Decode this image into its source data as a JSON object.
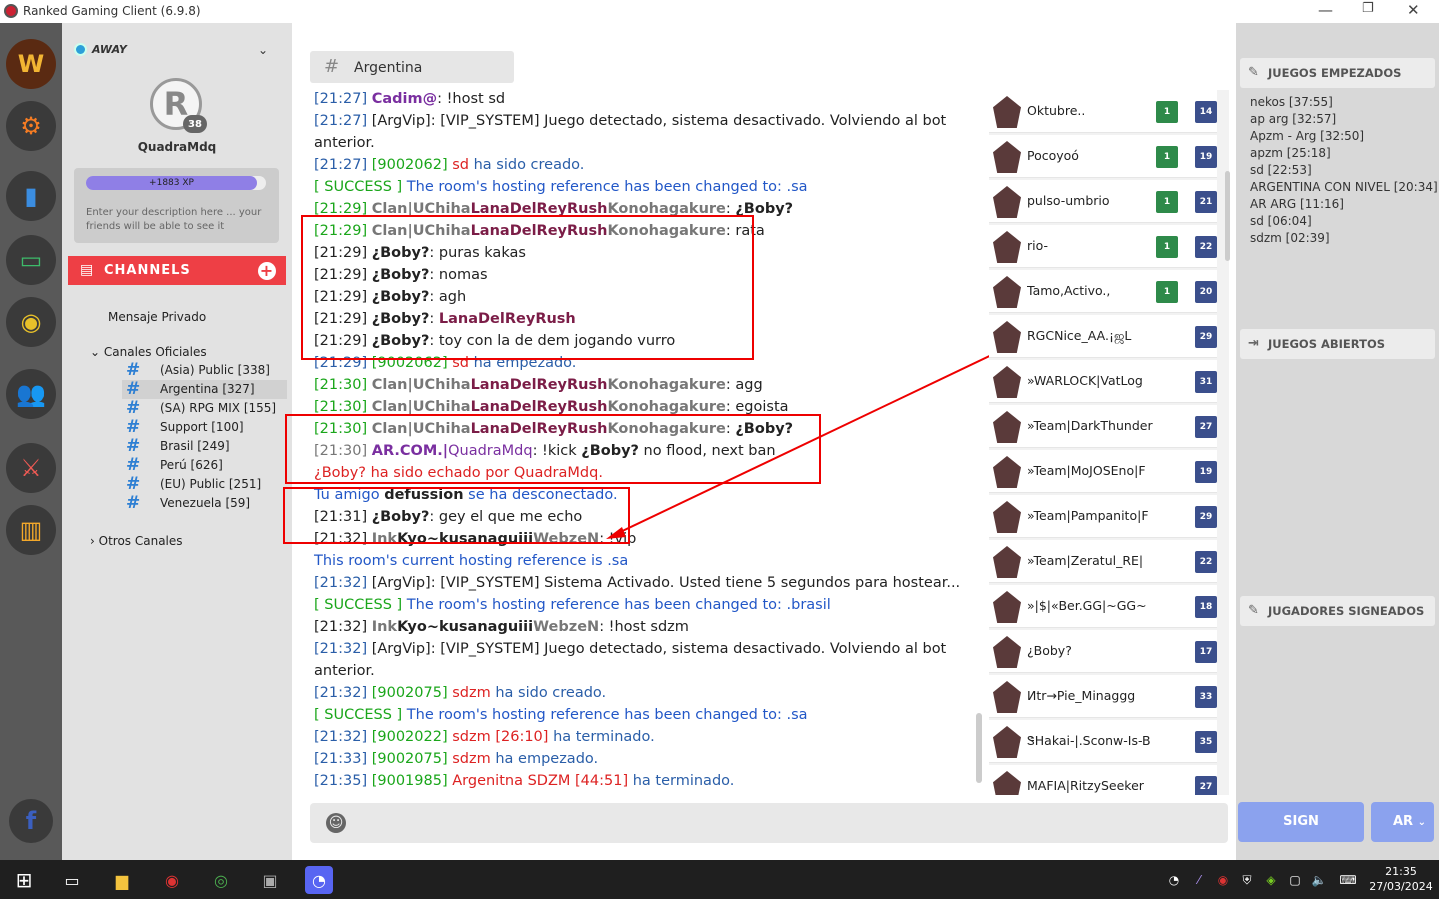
{
  "window": {
    "title": "Ranked Gaming Client (6.9.8)",
    "min": "—",
    "max": "❐",
    "close": "✕"
  },
  "sidebar": {
    "status": "AWAY",
    "avatar_letter": "R",
    "level": "38",
    "username": "QuadraMdq",
    "xp": "+1883 XP",
    "xp_fraction": 0.95,
    "description": "Enter your description here ... your friends will be able to see it",
    "channels_label": "CHANNELS",
    "private": "Mensaje Privado",
    "official_group": "Canales Oficiales",
    "other_group": "Otros Canales",
    "channels": [
      {
        "name": "(Asia) Public [338]"
      },
      {
        "name": "Argentina [327]"
      },
      {
        "name": "(SA) RPG MIX [155]"
      },
      {
        "name": "Support [100]"
      },
      {
        "name": "Brasil [249]"
      },
      {
        "name": "Perú [626]"
      },
      {
        "name": "(EU) Public [251]"
      },
      {
        "name": "Venezuela [59]"
      }
    ]
  },
  "chat": {
    "channel": "Argentina",
    "lines": [
      [
        [
          "[21:27] ",
          "tm"
        ],
        [
          "Cadim@",
          "mag b"
        ],
        [
          ": !host sd",
          ""
        ]
      ],
      [
        [
          "[21:27] ",
          "tm"
        ],
        [
          "[ArgVip]",
          ""
        ],
        [
          ": [VIP_SYSTEM] Juego detectado, sistema desactivado. Volviendo al bot",
          ""
        ]
      ],
      [
        [
          "anterior.",
          ""
        ]
      ],
      [
        [
          "[21:27] ",
          "tm"
        ],
        [
          "[9002062] ",
          "grn"
        ],
        [
          "sd ",
          "red"
        ],
        [
          "ha sido creado.",
          "tm"
        ]
      ],
      [
        [
          "[ SUCCESS ] ",
          "grn"
        ],
        [
          "The room's hosting reference has been changed to: ",
          "bl"
        ],
        [
          ".sa",
          "bl"
        ]
      ],
      [
        [
          "[21:29] ",
          "grn"
        ],
        [
          "Clan|UChiha",
          "gr b"
        ],
        [
          "LanaDelReyRush",
          "pur b"
        ],
        [
          "Konohagakure",
          "gr b"
        ],
        [
          ": ",
          ""
        ],
        [
          "¿Boby?",
          "b"
        ]
      ],
      [
        [
          "[21:29] ",
          "grn"
        ],
        [
          "Clan|UChiha",
          "gr b"
        ],
        [
          "LanaDelReyRush",
          "pur b"
        ],
        [
          "Konohagakure",
          "gr b"
        ],
        [
          ": rata",
          ""
        ]
      ],
      [
        [
          "[21:29] ",
          ""
        ],
        [
          "¿Boby?",
          "b"
        ],
        [
          ": puras kakas",
          ""
        ]
      ],
      [
        [
          "[21:29] ",
          ""
        ],
        [
          "¿Boby?",
          "b"
        ],
        [
          ": nomas",
          ""
        ]
      ],
      [
        [
          "[21:29] ",
          ""
        ],
        [
          "¿Boby?",
          "b"
        ],
        [
          ": agh",
          ""
        ]
      ],
      [
        [
          "[21:29] ",
          ""
        ],
        [
          "¿Boby?",
          "b"
        ],
        [
          ": ",
          ""
        ],
        [
          "LanaDelReyRush",
          "pur b"
        ]
      ],
      [
        [
          "[21:29] ",
          ""
        ],
        [
          "¿Boby?",
          "b"
        ],
        [
          ": toy con la de dem jogando vurro",
          ""
        ]
      ],
      [
        [
          "[21:29] ",
          "tm"
        ],
        [
          "[9002062] ",
          "grn"
        ],
        [
          "sd ",
          "red"
        ],
        [
          "ha empezado.",
          "tm"
        ]
      ],
      [
        [
          "[21:30] ",
          "grn"
        ],
        [
          "Clan|UChiha",
          "gr b"
        ],
        [
          "LanaDelReyRush",
          "pur b"
        ],
        [
          "Konohagakure",
          "gr b"
        ],
        [
          ": agg",
          ""
        ]
      ],
      [
        [
          "[21:30] ",
          "grn"
        ],
        [
          "Clan|UChiha",
          "gr b"
        ],
        [
          "LanaDelReyRush",
          "pur b"
        ],
        [
          "Konohagakure",
          "gr b"
        ],
        [
          ": egoista",
          ""
        ]
      ],
      [
        [
          "[21:30] ",
          "grn"
        ],
        [
          "Clan|UChiha",
          "gr b"
        ],
        [
          "LanaDelReyRush",
          "pur b"
        ],
        [
          "Konohagakure",
          "gr b"
        ],
        [
          ": ",
          ""
        ],
        [
          "¿Boby?",
          "b"
        ]
      ],
      [
        [
          "[21:30] ",
          "gr"
        ],
        [
          "AR.COM.|",
          "mag b"
        ],
        [
          "QuadraMdq",
          "mag"
        ],
        [
          ": !kick ",
          ""
        ],
        [
          "¿Boby?",
          "b"
        ],
        [
          " no flood, next ban",
          ""
        ]
      ],
      [
        [
          "¿Boby? ha sido echado por QuadraMdq.",
          "red"
        ]
      ],
      [
        [
          "Tu amigo ",
          "bl"
        ],
        [
          "defussion",
          "b"
        ],
        [
          " se ha desconectado.",
          "bl"
        ]
      ],
      [
        [
          "[21:31] ",
          ""
        ],
        [
          "¿Boby?",
          "b"
        ],
        [
          ": gey el que me echo",
          ""
        ]
      ],
      [
        [
          "[21:32] ",
          ""
        ],
        [
          "Ink",
          "gr b"
        ],
        [
          "Kyo~kusanaguiii",
          "b"
        ],
        [
          "WebzeN",
          "gr b"
        ],
        [
          ": !vip",
          ""
        ]
      ],
      [
        [
          "This room's current hosting reference is ",
          "bl"
        ],
        [
          ".sa",
          "bl"
        ]
      ],
      [
        [
          "[21:32] ",
          "tm"
        ],
        [
          "[ArgVip]",
          ""
        ],
        [
          ": [VIP_SYSTEM] Sistema Activado. Usted tiene 5 segundos para hostear...",
          ""
        ]
      ],
      [
        [
          "[ SUCCESS ] ",
          "grn"
        ],
        [
          "The room's hosting reference has been changed to: ",
          "bl"
        ],
        [
          ".brasil",
          "bl"
        ]
      ],
      [
        [
          "[21:32] ",
          ""
        ],
        [
          "Ink",
          "gr b"
        ],
        [
          "Kyo~kusanaguiii",
          "b"
        ],
        [
          "WebzeN",
          "gr b"
        ],
        [
          ": !host sdzm",
          ""
        ]
      ],
      [
        [
          "[21:32] ",
          "tm"
        ],
        [
          "[ArgVip]",
          ""
        ],
        [
          ": [VIP_SYSTEM] Juego detectado, sistema desactivado. Volviendo al bot",
          ""
        ]
      ],
      [
        [
          "anterior.",
          ""
        ]
      ],
      [
        [
          "[21:32] ",
          "tm"
        ],
        [
          "[9002075] ",
          "grn"
        ],
        [
          "sdzm ",
          "red"
        ],
        [
          "ha sido creado.",
          "tm"
        ]
      ],
      [
        [
          "[ SUCCESS ] ",
          "grn"
        ],
        [
          "The room's hosting reference has been changed to: ",
          "bl"
        ],
        [
          ".sa",
          "bl"
        ]
      ],
      [
        [
          "[21:32] ",
          "tm"
        ],
        [
          "[9002022] ",
          "grn"
        ],
        [
          "sdzm [26:10] ",
          "red"
        ],
        [
          "ha terminado.",
          "tm"
        ]
      ],
      [
        [
          "[21:33] ",
          "tm"
        ],
        [
          "[9002075] ",
          "grn"
        ],
        [
          "sdzm ",
          "red"
        ],
        [
          "ha empezado.",
          "tm"
        ]
      ],
      [
        [
          "[21:35] ",
          "tm"
        ],
        [
          "[9001985] ",
          "grn"
        ],
        [
          "Argenitna SDZM [44:51] ",
          "red"
        ],
        [
          "ha terminado.",
          "tm"
        ]
      ]
    ]
  },
  "users": [
    {
      "name": "Oktubre..",
      "games": "1",
      "level": "14"
    },
    {
      "name": "Pocoyoó",
      "games": "1",
      "level": "19"
    },
    {
      "name": "pulso-umbrio",
      "games": "1",
      "level": "21"
    },
    {
      "name": "rio-",
      "games": "1",
      "level": "22"
    },
    {
      "name": "Tamo,Activo.,",
      "games": "1",
      "level": "20"
    },
    {
      "name": "RGCNice_AA.¡ஜL",
      "games": "",
      "level": "29"
    },
    {
      "name": "»WARLOCK|VatLog",
      "games": "",
      "level": "31"
    },
    {
      "name": "»Team|DarkThunder",
      "games": "",
      "level": "27"
    },
    {
      "name": "»Team|MoJOSEno|F",
      "games": "",
      "level": "19"
    },
    {
      "name": "»Team|Pampanito|F",
      "games": "",
      "level": "29"
    },
    {
      "name": "»Team|Zeratul_RE|",
      "games": "",
      "level": "22"
    },
    {
      "name": "»|$|«Ber.GG|~GG~",
      "games": "",
      "level": "18"
    },
    {
      "name": "¿Boby?",
      "games": "",
      "level": "17"
    },
    {
      "name": "Иtr→Pie_Minaggg",
      "games": "",
      "level": "33"
    },
    {
      "name": "ᏕHakai-|.Sconw-Is-B",
      "games": "",
      "level": "35"
    },
    {
      "name": "MAFIA|RitzySeeker",
      "games": "",
      "level": "27"
    }
  ],
  "right": {
    "started_label": "JUEGOS EMPEZADOS",
    "started": [
      "nekos [37:55]",
      "ap arg [32:57]",
      "Apzm - Arg [32:50]",
      "apzm [25:18]",
      "sd [22:53]",
      "ARGENTINA CON NIVEL [20:34]",
      "AR ARG [11:16]",
      "sd [06:04]",
      "sdzm [02:39]"
    ],
    "open_label": "JUEGOS ABIERTOS",
    "signed_label": "JUGADORES SIGNEADOS",
    "sign_button": "SIGN",
    "region_button": "AR"
  },
  "taskbar": {
    "time": "21:35",
    "date": "27/03/2024"
  },
  "colors": {
    "accent_red": "#ee3f45",
    "sign_blue": "#8ba2ee",
    "status_blue": "#2d9fd9"
  }
}
